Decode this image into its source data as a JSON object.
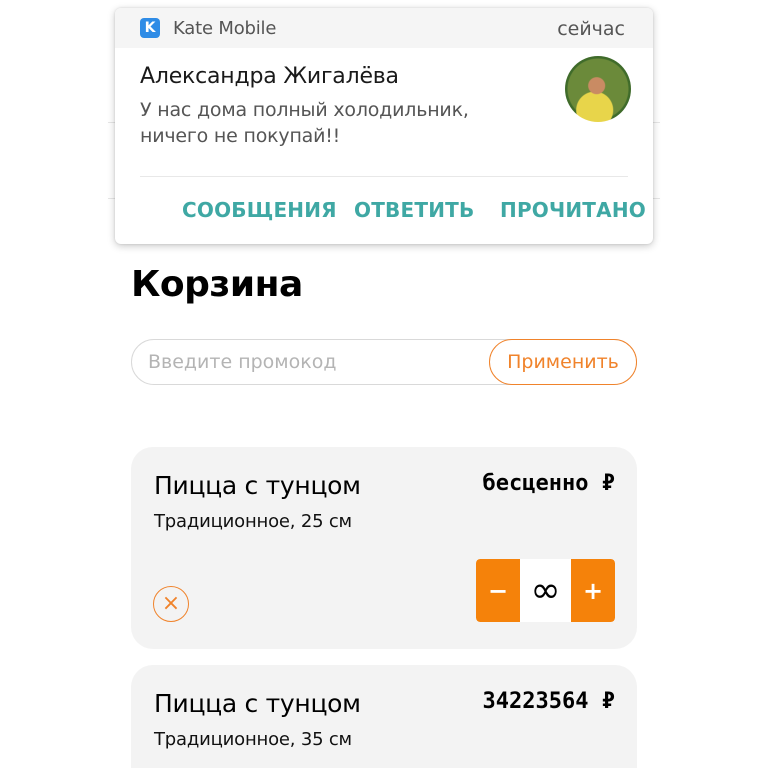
{
  "notification": {
    "app_icon_letter": "K",
    "app_name": "Kate Mobile",
    "time": "сейчас",
    "sender": "Александра Жигалёва",
    "message": "У нас дома полный холодильник, ничего не покупай!!",
    "actions": [
      "СООБЩЕНИЯ",
      "ОТВЕТИТЬ",
      "ПРОЧИТАНО"
    ],
    "accent_color": "#3fa8a4"
  },
  "page": {
    "title": "Корзина"
  },
  "promo": {
    "placeholder": "Введите промокод",
    "value": "",
    "apply_label": "Применить"
  },
  "cart_items": [
    {
      "name": "Пицца с тунцом",
      "variant": "Традиционное, 25 см",
      "price": "бесценно ₽",
      "quantity": "∞",
      "remove_icon": "×",
      "minus": "−",
      "plus": "+"
    },
    {
      "name": "Пицца с тунцом",
      "variant": "Традиционное, 35 см",
      "price": "34223564 ₽"
    }
  ],
  "colors": {
    "brand_orange": "#f5820a",
    "card_bg": "#f3f3f3"
  }
}
